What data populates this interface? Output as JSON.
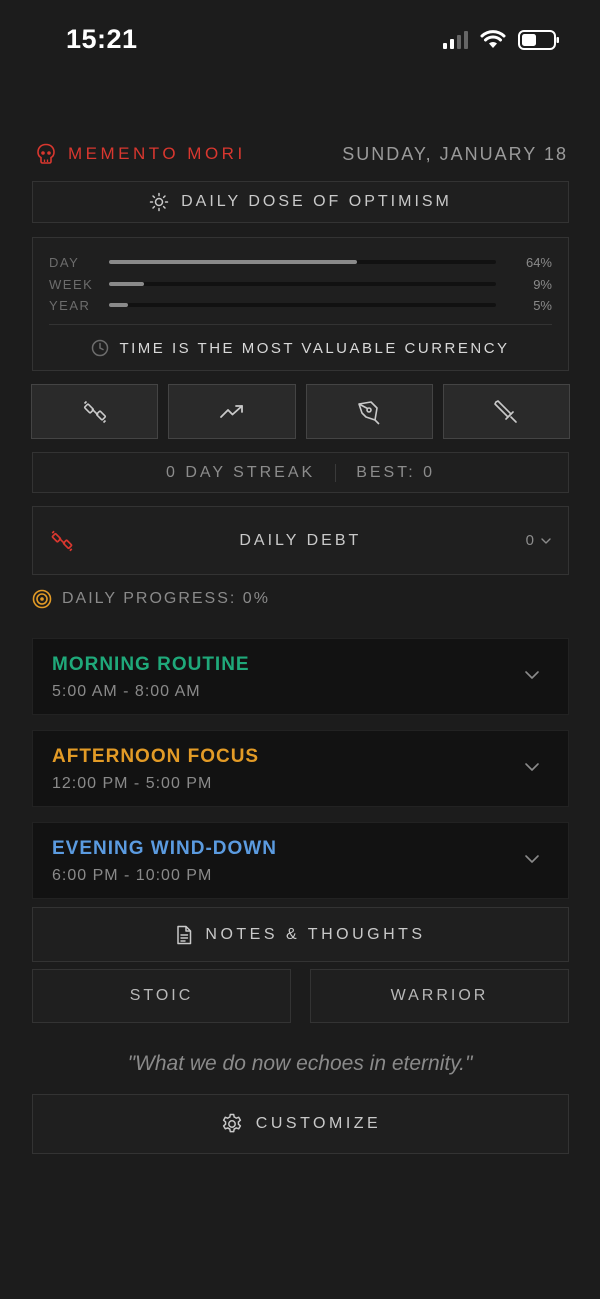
{
  "status_bar": {
    "time": "15:21"
  },
  "header": {
    "brand": "MEMENTO MORI",
    "date": "SUNDAY, JANUARY 18"
  },
  "optimism": {
    "label": "DAILY DOSE OF OPTIMISM"
  },
  "time_progress": {
    "rows": [
      {
        "label": "DAY",
        "value_text": "64%",
        "fraction": 0.64
      },
      {
        "label": "WEEK",
        "value_text": "9%",
        "fraction": 0.09
      },
      {
        "label": "YEAR",
        "value_text": "5%",
        "fraction": 0.05
      }
    ],
    "motto": "TIME IS THE MOST VALUABLE CURRENCY"
  },
  "tools": [
    "dumbbell-icon",
    "trending-up-icon",
    "pen-nib-icon",
    "sword-icon"
  ],
  "streak": {
    "current": "0 DAY STREAK",
    "best": "BEST: 0"
  },
  "debt": {
    "title": "DAILY DEBT",
    "value": "0"
  },
  "daily_progress": {
    "label": "DAILY PROGRESS: 0%"
  },
  "routines": [
    {
      "title": "MORNING ROUTINE",
      "time": "5:00 AM - 8:00 AM",
      "color": "#1fa97a"
    },
    {
      "title": "AFTERNOON FOCUS",
      "time": "12:00 PM - 5:00 PM",
      "color": "#e39b26"
    },
    {
      "title": "EVENING WIND-DOWN",
      "time": "6:00 PM - 10:00 PM",
      "color": "#5b9be0"
    }
  ],
  "notes": {
    "label": "NOTES & THOUGHTS"
  },
  "modes": [
    "STOIC",
    "WARRIOR"
  ],
  "quote": "\"What we do now echoes in eternity.\"",
  "customize": {
    "label": "CUSTOMIZE"
  },
  "colors": {
    "accent_red": "#d9372f",
    "background": "#1c1c1c",
    "card": "#1f1f1f"
  }
}
